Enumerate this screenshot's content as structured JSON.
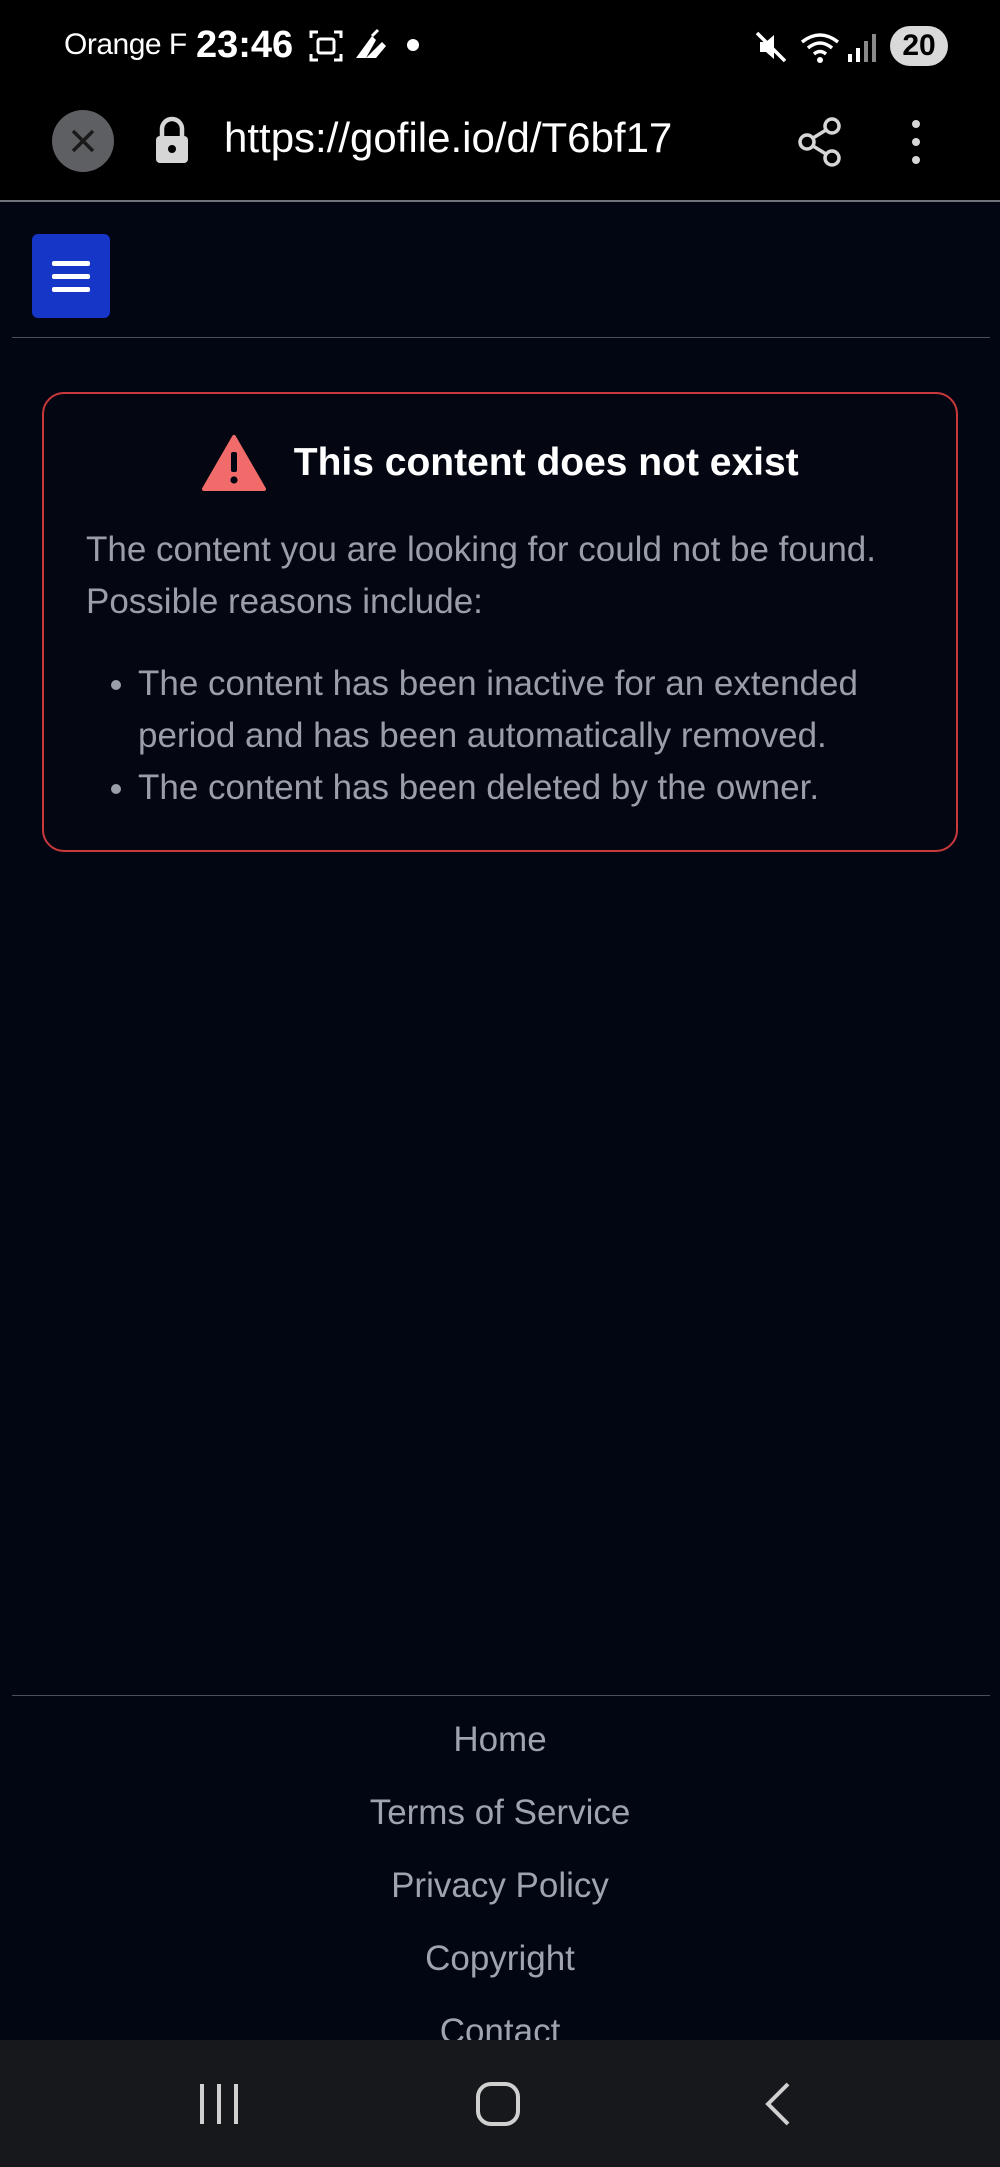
{
  "status_bar": {
    "carrier": "Orange F",
    "time": "23:46",
    "battery": "20",
    "icons": [
      "screenshot-icon",
      "app-icon",
      "dot-icon",
      "mute-icon",
      "wifi-icon",
      "signal-icon"
    ]
  },
  "browser": {
    "url": "https://gofile.io/d/T6bf17",
    "icons": [
      "close-icon",
      "lock-icon",
      "share-icon",
      "more-vert-icon"
    ]
  },
  "alert": {
    "title": "This content does not exist",
    "description": "The content you are looking for could not be found. Possible reasons include:",
    "reasons": [
      "The content has been inactive for an extended period and has been automatically removed.",
      "The content has been deleted by the owner."
    ],
    "icon": "warning-icon",
    "border_color": "#c9393b"
  },
  "footer": {
    "links": [
      "Home",
      "Terms of Service",
      "Privacy Policy",
      "Copyright",
      "Contact"
    ]
  },
  "colors": {
    "background": "#020512",
    "menu_button": "#1636c8",
    "warning": "#f26b6b"
  }
}
